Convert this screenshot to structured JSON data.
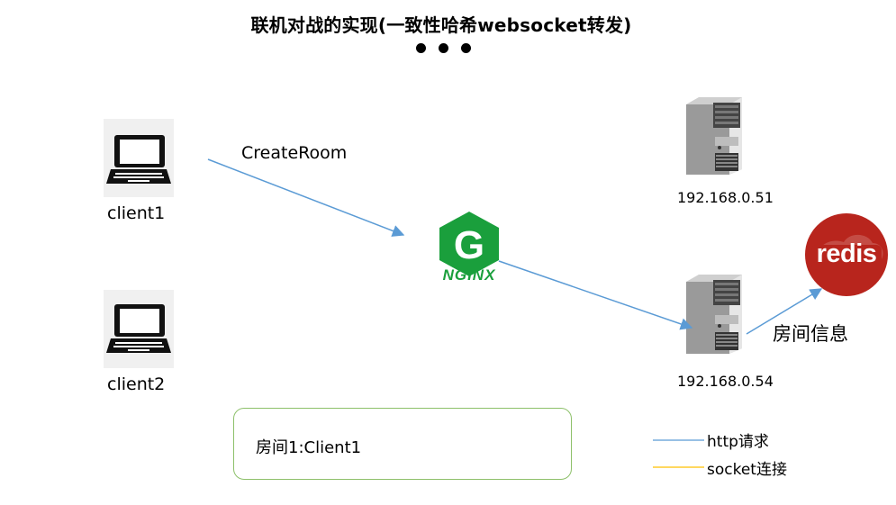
{
  "title": "联机对战的实现(一致性哈希websocket转发)",
  "clients": [
    {
      "name": "client1",
      "icon": "laptop-icon"
    },
    {
      "name": "client2",
      "icon": "laptop-icon"
    }
  ],
  "request_label": "CreateRoom",
  "nginx": {
    "logo_letter": "G",
    "logo_text": "NGINX",
    "color": "#1a9f3c"
  },
  "servers": [
    {
      "ip": "192.168.0.51",
      "icon": "server-tower-icon"
    },
    {
      "ip": "192.168.0.54",
      "icon": "server-tower-icon"
    }
  ],
  "redis": {
    "logo_text": "redis",
    "color": "#b8251d",
    "label": "房间信息"
  },
  "room_box": {
    "text": "房间1:Client1",
    "border_color": "#8dc06a"
  },
  "legend": [
    {
      "label": "http请求",
      "color": "#5b9bd5"
    },
    {
      "label": "socket连接",
      "color": "#ffc000"
    }
  ],
  "arrow_color": "#5b9bd5"
}
